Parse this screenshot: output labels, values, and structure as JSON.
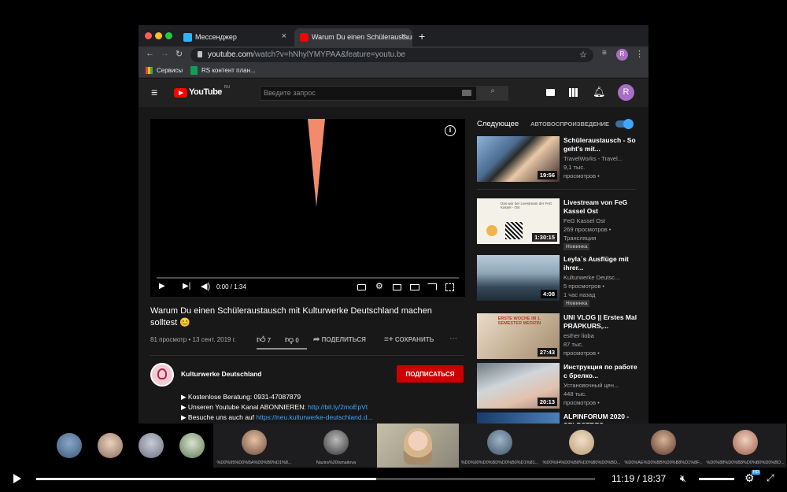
{
  "browser": {
    "tabs": [
      {
        "label": "Мессенджер",
        "active": false,
        "close": "×"
      },
      {
        "label": "Warum Du einen Schüleraustausch",
        "active": true,
        "close": "×"
      }
    ],
    "new_tab": "+",
    "url_host": "youtube.com",
    "url_path": "/watch?v=hNhylYMYPAA&feature=youtu.be",
    "profile_initial": "R",
    "bookmarks": [
      {
        "label": "Сервисы",
        "icon": "apps-icon"
      },
      {
        "label": "RS контент план...",
        "icon": "sheets-icon"
      }
    ]
  },
  "youtube": {
    "logo_text": "YouTube",
    "logo_region": "RU",
    "search_placeholder": "Введите запрос",
    "profile_initial": "R",
    "player": {
      "time_current": "0:00",
      "time_separator": " / ",
      "time_total": "1:34",
      "progress": 0.0
    },
    "video": {
      "title": "Warum Du einen Schüleraustausch mit Kulturwerke Deutschland machen solltest 😊",
      "views": "81 просмотр",
      "date": "13 сент. 2019 г.",
      "likes": "7",
      "dislikes": "0",
      "share_label": "ПОДЕЛИТЬСЯ",
      "save_label": "СОХРАНИТЬ",
      "more_label": "⋯"
    },
    "channel": {
      "name": "Kulturwerke Deutschland",
      "subscribe_label": "ПОДПИСАТЬСЯ"
    },
    "description": [
      {
        "text": "Kostenlose Beratung: 0931-47087879",
        "link": ""
      },
      {
        "text": "Unseren Youtube Kanal ABONNIEREN: ",
        "link": "http://bit.ly/2moEpVt"
      },
      {
        "text": "Besuche uns auch auf ",
        "link": "https://neu.kulturwerke-deutschland.d..."
      }
    ],
    "sidebar": {
      "up_next": "Следующее",
      "autoplay_label": "АВТОВОСПРОИЗВЕДЕНИЕ",
      "autoplay_on": true,
      "items": [
        {
          "title": "Schüleraustausch - So geht's mit...",
          "channel": "TravelWorks - Travel...",
          "line3": "9,1 тыс.",
          "line4": "просмотров •",
          "duration": "19:56",
          "badge": ""
        },
        {
          "title": "Livestream von FeG Kassel Ost",
          "channel": "FeG Kassel Ost",
          "line3": "269 просмотров •",
          "line4": "Трансляция",
          "duration": "1:30:15",
          "badge": "Новинка"
        },
        {
          "title": "Leyla´s Ausflüge mit ihrer...",
          "channel": "Kulturwerke Deutsc...",
          "line3": "5 просмотров •",
          "line4": "1 час назад",
          "duration": "4:08",
          "badge": "Новинка"
        },
        {
          "title": "UNI VLOG || Erstes Mal PRÄPKURS,...",
          "channel": "esther lioba",
          "line3": "87 тыс.",
          "line4": "просмотров •",
          "duration": "27:43",
          "badge": ""
        },
        {
          "title": "Инструкция по работе с брелко...",
          "channel": "Установочный цен...",
          "line3": "448 тыс.",
          "line4": "просмотров •",
          "duration": "20:13",
          "badge": ""
        },
        {
          "title": "ALPINFORUM 2020 - SELBSTBES...",
          "channel": "",
          "line3": "",
          "line4": "",
          "duration": "",
          "badge": ""
        }
      ],
      "thumb2_text": "Das war der Livestream der FeG Kassel - Ost",
      "thumb4_text": "ERSTE WOCHE IM 1. SEMESTER MEDIZIN"
    }
  },
  "meeting": {
    "participants": [
      {
        "label": "%D0%95%D0%BA%D0%B0%D1%8..."
      },
      {
        "label": "Nazira%20Ismailova"
      },
      {
        "label": ""
      },
      {
        "label": "%D0%90%D0%BD%D0%B0%D1%81..."
      },
      {
        "label": "%D0%94%D0%B8%D0%B0%D0%BD..."
      },
      {
        "label": "%D0%AE%D0%BB%D0%B8%D1%8F..."
      },
      {
        "label": "%D0%88%D0%B8%D0%B0%D0%BD..."
      }
    ],
    "playback": {
      "current": "11:19",
      "separator": " / ",
      "total": "18:37",
      "progress": 0.608,
      "speed_badge": "HD"
    }
  }
}
